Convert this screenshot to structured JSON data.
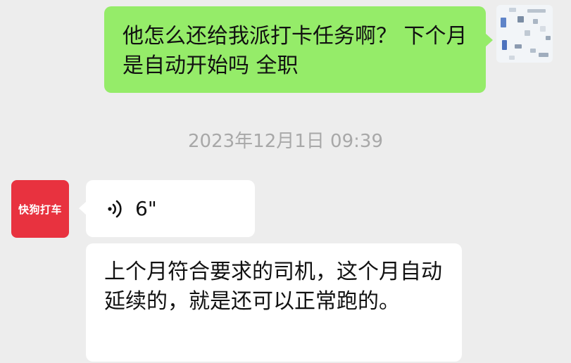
{
  "conversation": {
    "outgoing_message": {
      "text": "他怎么还给我派打卡任务啊？ 下个月是自动开始吗 全职"
    },
    "timestamp": "2023年12月1日 09:39",
    "incoming": {
      "avatar_label": "快狗打车",
      "voice_message": {
        "duration": "6\""
      },
      "text_message": {
        "text": "上个月符合要求的司机，这个月自动延续的，就是还可以正常跑的。"
      }
    }
  },
  "colors": {
    "background": "#ededed",
    "outgoing_bubble": "#95ec69",
    "incoming_bubble": "#ffffff",
    "avatar_brand": "#e8323f",
    "timestamp_text": "#a8a8a8"
  },
  "icons": {
    "voice": "voice-wave-icon"
  }
}
